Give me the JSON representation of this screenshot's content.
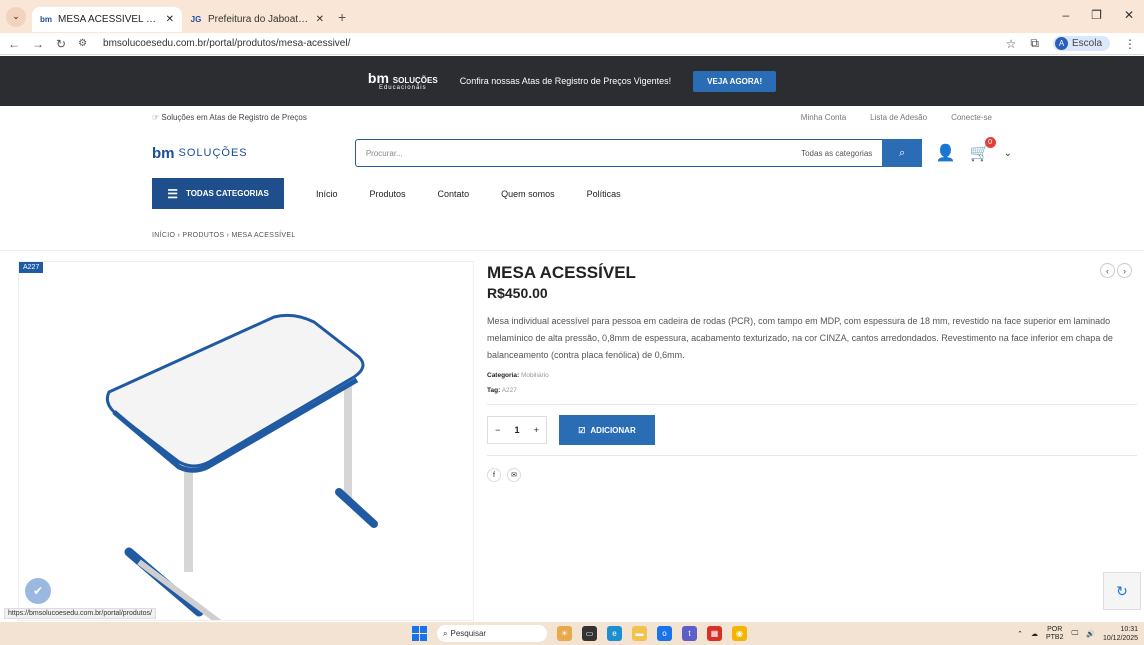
{
  "browser": {
    "tabs": [
      {
        "title": "MESA ACESSÍVEL – Portal BM",
        "favicon": "bm"
      },
      {
        "title": "Prefeitura do Jaboatão dos Gua",
        "favicon": "JG"
      }
    ],
    "url": "bmsolucoesedu.com.br/portal/produtos/mesa-acessivel/",
    "profile": "Escola",
    "profile_initial": "A",
    "status_url": "https://bmsolucoesedu.com.br/portal/produtos/"
  },
  "promo": {
    "logo": "bm",
    "logo_text": "SOLUÇÕES",
    "logo_sub": "Educacionais",
    "text": "Confira nossas Atas de Registro de Preços Vigentes!",
    "button": "VEJA AGORA!"
  },
  "topline": {
    "tagline": "Soluções em Atas de Registro de Preços",
    "links": [
      "Minha Conta",
      "Lista de Adesão",
      "Conecte-se"
    ]
  },
  "header": {
    "logo": "bm",
    "logo_text": "SOLUÇÕES",
    "search_placeholder": "Procurar...",
    "category_select": "Todas as categorias",
    "cart_count": "0"
  },
  "nav": {
    "all_categories": "TODAS CATEGORIAS",
    "items": [
      "Início",
      "Produtos",
      "Contato",
      "Quem somos",
      "Políticas"
    ]
  },
  "breadcrumb": [
    "INÍCIO",
    "PRODUTOS",
    "MESA ACESSÍVEL"
  ],
  "product": {
    "badge": "A227",
    "title": "MESA ACESSÍVEL",
    "price": "R$450.00",
    "description": "Mesa individual acessível para pessoa em cadeira de rodas (PCR), com tampo em MDP, com espessura de 18 mm, revestido na face superior em laminado melamínico de alta pressão, 0,8mm de espessura, acabamento texturizado, na cor CINZA, cantos arredondados. Revestimento na face inferior em chapa de balanceamento (contra placa fenólica) de 0,6mm.",
    "category_label": "Categoria:",
    "category": "Mobiliário",
    "tag_label": "Tag:",
    "tag": "A227",
    "quantity": "1",
    "add_button": "ADICIONAR"
  },
  "taskbar": {
    "search": "Pesquisar",
    "lang": "POR",
    "lang_sub": "PTB2",
    "time": "10:31",
    "date": "10/12/2025"
  }
}
